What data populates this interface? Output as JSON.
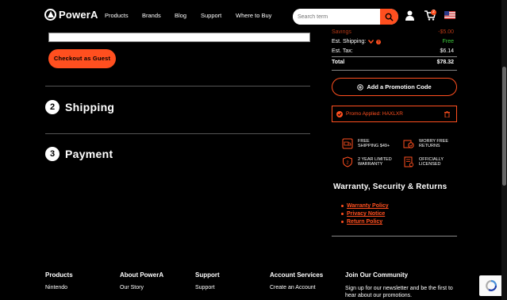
{
  "header": {
    "brand": "PowerA",
    "nav": [
      "Products",
      "Brands",
      "Blog",
      "Support",
      "Where to Buy"
    ],
    "search_placeholder": "Search term",
    "cart_count": "2"
  },
  "checkout": {
    "guest_button": "Checkout as Guest",
    "steps": [
      {
        "num": "2",
        "title": "Shipping"
      },
      {
        "num": "3",
        "title": "Payment"
      }
    ]
  },
  "summary": {
    "savings_label": "Savings",
    "savings_value": "-$5.00",
    "shipping_label": "Est. Shipping:",
    "shipping_value": "Free",
    "tax_label": "Est. Tax:",
    "tax_value": "$6.14",
    "total_label": "Total",
    "total_value": "$78.32",
    "promo_button": "Add a Promotion Code",
    "promo_applied": "Promo Applied: HAXLXR"
  },
  "features": [
    {
      "line1": "FREE",
      "line2": "SHIPPING $49+",
      "icon": "truck-icon"
    },
    {
      "line1": "WORRY FREE",
      "line2": "RETURNS",
      "icon": "return-icon"
    },
    {
      "line1": "2 YEAR LIMITED",
      "line2": "WARRANTY",
      "icon": "shield-icon"
    },
    {
      "line1": "OFFICIALLY",
      "line2": "LICENSED",
      "icon": "license-icon"
    }
  ],
  "warranty": {
    "title": "Warranty, Security & Returns",
    "links": [
      "Warranty Policy",
      "Privacy Notice",
      "Return Policy"
    ]
  },
  "footer": {
    "cols": [
      {
        "heading": "Products",
        "link": "Nintendo"
      },
      {
        "heading": "About PowerA",
        "link": "Our Story"
      },
      {
        "heading": "Support",
        "link": "Support"
      },
      {
        "heading": "Account Services",
        "link": "Create an Account"
      }
    ],
    "community_heading": "Join Our Community",
    "community_text": "Sign up for our newsletter and be the first to hear about our promotions."
  },
  "colors": {
    "accent": "#ff4f1f",
    "background": "#000000",
    "success": "#3ccc3c"
  }
}
